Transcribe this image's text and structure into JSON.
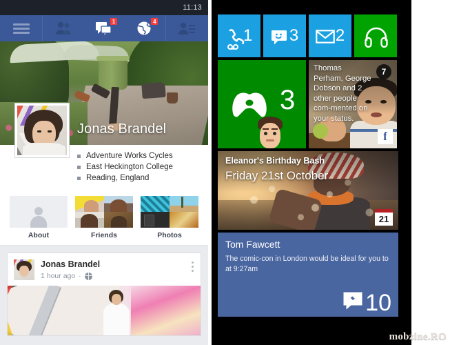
{
  "left_phone": {
    "status_bar": {
      "time": "11:13"
    },
    "nav": {
      "menu_icon": "hamburger-menu-icon",
      "items": [
        {
          "icon": "friends-icon",
          "name": "friends",
          "badge": null
        },
        {
          "icon": "messages-icon",
          "name": "messages",
          "badge": "1"
        },
        {
          "icon": "globe-notifications-icon",
          "name": "notifications",
          "badge": "4"
        },
        {
          "icon": "friend-requests-icon",
          "name": "friend-requests",
          "badge": null
        }
      ]
    },
    "profile": {
      "name": "Jonas Brandel",
      "facts": [
        "Adventure Works Cycles",
        "East Heckington College",
        "Reading, England"
      ]
    },
    "quick_links": [
      {
        "label": "About",
        "thumb": "about-placeholder-icon"
      },
      {
        "label": "Friends",
        "thumb": "friends-photo-grid"
      },
      {
        "label": "Photos",
        "thumb": "photos-grid"
      }
    ],
    "post": {
      "author": "Jonas Brandel",
      "time": "1 hour ago",
      "separator": "·",
      "privacy_icon": "globe-public-icon",
      "menu_icon": "kebab-menu-icon"
    }
  },
  "right_phone": {
    "tiles": [
      {
        "name": "phone",
        "icon": "phone-voicemail-icon",
        "count": "1",
        "color": "#1ba1e2",
        "size": "small"
      },
      {
        "name": "messaging",
        "icon": "messaging-smiley-icon",
        "count": "3",
        "color": "#1ba1e2",
        "size": "small"
      },
      {
        "name": "email",
        "icon": "envelope-icon",
        "count": "2",
        "color": "#1ba1e2",
        "size": "small"
      },
      {
        "name": "music",
        "icon": "headphones-icon",
        "count": "",
        "color": "#00a300",
        "size": "small"
      },
      {
        "name": "xbox",
        "icon": "xbox-controller-icon",
        "count": "3",
        "color": "#008a00",
        "size": "medium"
      },
      {
        "name": "facebook",
        "icon": "facebook-logo-icon",
        "badge": "7",
        "size": "medium",
        "text": "Thomas Perham, George Dobson and 2 other people com‑mented on your status."
      },
      {
        "name": "calendar",
        "size": "wide",
        "badge": "21",
        "title": "Eleanor's Birthday Bash",
        "date": "Friday 21st October"
      },
      {
        "name": "messenger",
        "size": "wide",
        "color": "#4a66a0",
        "author": "Tom Fawcett",
        "message": "The comic-con in London would be ideal for you to at 9:27am",
        "count": "10",
        "icon": "messenger-bolt-icon"
      }
    ]
  },
  "watermark": {
    "text": "mobzine.RO"
  },
  "colors": {
    "facebook_blue": "#3b5998",
    "status_dark": "#1d2129",
    "tile_cyan": "#1ba1e2",
    "tile_green": "#00a300",
    "xbox_green": "#008a00",
    "messenger_blue": "#4a66a0",
    "badge_red": "#fb3b3b"
  }
}
